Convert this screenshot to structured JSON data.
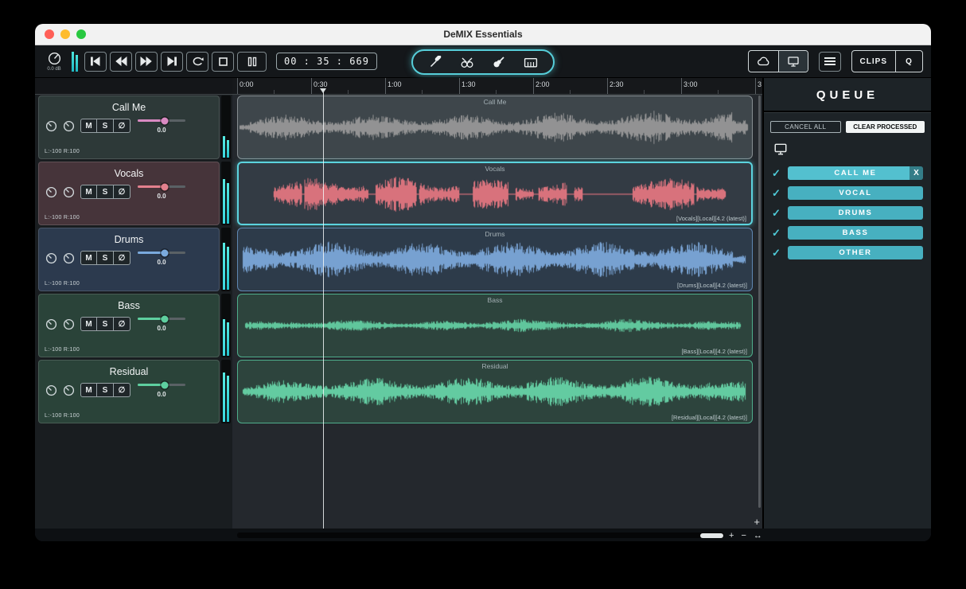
{
  "window": {
    "title": "DeMIX Essentials"
  },
  "toolbar": {
    "volume_db": "0.0 dB",
    "time": "00 : 35 : 669",
    "clips": "CLIPS",
    "queue": "Q"
  },
  "ruler": {
    "ticks": [
      "0:00",
      "0:30",
      "1:00",
      "1:30",
      "2:00",
      "2:30",
      "3:00",
      "3"
    ]
  },
  "controls": {
    "mute": "M",
    "solo": "S",
    "phase": "∅"
  },
  "icons": {
    "check": "✓",
    "close": "X"
  },
  "zoom": {
    "plus": "+",
    "minus": "−",
    "hfit": "↔",
    "corner_plus": "+"
  },
  "colors": {
    "accent": "#54cdd8",
    "queue_item": "#47b0c0",
    "meter": "#3cd9e0"
  },
  "tracks": [
    {
      "name": "Call Me",
      "gain": "0.0",
      "pan": "L:-100 R:100",
      "info": "",
      "header_bg": "#2d3938",
      "accent": "#d98ac2",
      "region_bg": "#3e464b",
      "region_border": "#878e92",
      "wave_color": "#979797",
      "selected": false,
      "seed": 11,
      "meter": [
        0.34,
        0.28
      ],
      "envelope": [
        [
          0,
          0.02,
          0.3
        ],
        [
          0.02,
          0.55,
          0.62
        ],
        [
          0.55,
          0.8,
          0.72
        ],
        [
          0.8,
          0.965,
          0.85
        ],
        [
          0.965,
          0.995,
          0.4
        ]
      ]
    },
    {
      "name": "Vocals",
      "gain": "0.0",
      "pan": "L:-100 R:100",
      "info": "[Vocals][Local][4.2 (latest)]",
      "header_bg": "#46343a",
      "accent": "#e2808d",
      "region_bg": "#333b44",
      "region_border": "#5bd3de",
      "wave_color": "#e2757f",
      "selected": true,
      "seed": 22,
      "meter": [
        0.7,
        0.64
      ],
      "envelope": [
        [
          0.065,
          0.12,
          0.72
        ],
        [
          0.125,
          0.25,
          0.8
        ],
        [
          0.265,
          0.345,
          0.85
        ],
        [
          0.35,
          0.43,
          0.8
        ],
        [
          0.455,
          0.525,
          0.75
        ],
        [
          0.54,
          0.575,
          0.55
        ],
        [
          0.585,
          0.64,
          0.7
        ],
        [
          0.655,
          0.672,
          0.35
        ],
        [
          0.77,
          0.89,
          0.8
        ],
        [
          0.895,
          0.952,
          0.62
        ]
      ]
    },
    {
      "name": "Drums",
      "gain": "0.0",
      "pan": "L:-100 R:100",
      "info": "[Drums][Local][4.2 (latest)]",
      "header_bg": "#2c3a4e",
      "accent": "#7aa9dd",
      "region_bg": "#2d3b4a",
      "region_border": "#5f87b2",
      "wave_color": "#7ba6d8",
      "selected": false,
      "seed": 33,
      "meter": [
        0.74,
        0.68
      ],
      "envelope": [
        [
          0.005,
          0.05,
          0.68
        ],
        [
          0.05,
          0.92,
          0.86
        ],
        [
          0.92,
          0.965,
          0.9
        ],
        [
          0.965,
          0.99,
          0.45
        ]
      ]
    },
    {
      "name": "Bass",
      "gain": "0.0",
      "pan": "L:-100 R:100",
      "info": "[Bass][Local][4.2 (latest)]",
      "header_bg": "#2a4339",
      "accent": "#5ecf9f",
      "region_bg": "#2d443d",
      "region_border": "#4fae8c",
      "wave_color": "#63cda1",
      "selected": false,
      "seed": 44,
      "meter": [
        0.58,
        0.52
      ],
      "envelope": [
        [
          0.01,
          0.1,
          0.2
        ],
        [
          0.1,
          0.3,
          0.28
        ],
        [
          0.3,
          0.48,
          0.22
        ],
        [
          0.48,
          0.56,
          0.38
        ],
        [
          0.56,
          0.72,
          0.26
        ],
        [
          0.72,
          0.85,
          0.32
        ],
        [
          0.85,
          0.98,
          0.22
        ]
      ]
    },
    {
      "name": "Residual",
      "gain": "0.0",
      "pan": "L:-100 R:100",
      "info": "[Residual][Local][4.2 (latest)]",
      "header_bg": "#2a4339",
      "accent": "#5ecf9f",
      "region_bg": "#2d443d",
      "region_border": "#4fae8c",
      "wave_color": "#66d3a6",
      "selected": false,
      "seed": 55,
      "meter": [
        0.78,
        0.72
      ],
      "envelope": [
        [
          0.005,
          0.15,
          0.55
        ],
        [
          0.15,
          0.45,
          0.68
        ],
        [
          0.45,
          0.75,
          0.72
        ],
        [
          0.75,
          0.92,
          0.76
        ],
        [
          0.92,
          0.99,
          0.5
        ]
      ]
    }
  ],
  "queue": {
    "title": "QUEUE",
    "cancel_all": "CANCEL ALL",
    "clear_processed": "CLEAR PROCESSED",
    "items": [
      {
        "label": "CALL ME",
        "selected": true
      },
      {
        "label": "VOCAL",
        "selected": false
      },
      {
        "label": "DRUMS",
        "selected": false
      },
      {
        "label": "BASS",
        "selected": false
      },
      {
        "label": "OTHER",
        "selected": false
      }
    ]
  }
}
